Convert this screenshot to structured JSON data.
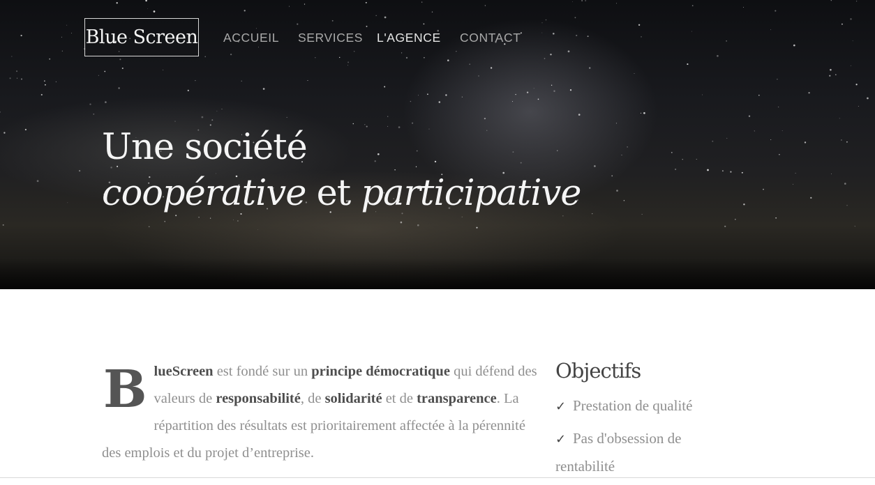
{
  "brand": {
    "name": "Blue Screen"
  },
  "nav": {
    "items": [
      {
        "label": "ACCUEIL",
        "active": false
      },
      {
        "label": "SERVICES",
        "active": false
      },
      {
        "label": "L'AGENCE",
        "active": true
      },
      {
        "label": "CONTACT",
        "active": false
      }
    ]
  },
  "hero": {
    "line1": "Une société",
    "line2_part1": "coopérative",
    "line2_part2": " et ",
    "line2_part3": "participative"
  },
  "intro": {
    "dropcap": "B",
    "t1": "lueScreen",
    "t2": " est fondé sur un ",
    "t3": "principe démocratique",
    "t4": " qui défend des valeurs de ",
    "t5": "responsabilité",
    "t6": ", de ",
    "t7": "solidarité",
    "t8": " et de ",
    "t9": "transparence",
    "t10": ". La répartition des résultats est prioritairement affectée à la pérennité des emplois et du projet d’entreprise."
  },
  "objectives": {
    "title": "Objectifs",
    "icon": "check-icon",
    "items": [
      "Prestation de qualité",
      "Pas d'obsession de rentabilité"
    ]
  },
  "colors": {
    "hero_text": "#f5f5f5",
    "nav_inactive": "#a9a9a9",
    "nav_active": "#e6e6e6",
    "body_text": "#8f8f8f",
    "strong_text": "#4d4d4d"
  }
}
